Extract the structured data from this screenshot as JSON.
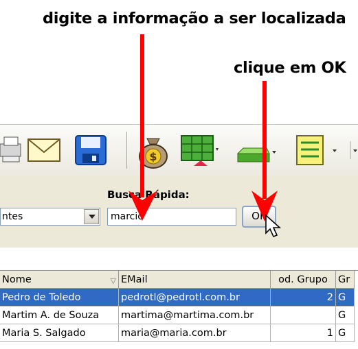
{
  "annotations": {
    "type_hint": "digite a informação a ser localizada",
    "click_hint": "clique em OK"
  },
  "toolbar": {
    "icons": [
      "printer-icon",
      "email-icon",
      "save-icon",
      "money-bag-icon",
      "spreadsheet-icon",
      "green-box-icon",
      "list-icon"
    ]
  },
  "search": {
    "label": "Busca Rápida:",
    "combo_value": "ntes",
    "input_value": "marcio",
    "ok_label": "OK"
  },
  "table": {
    "columns": [
      "Nome",
      "EMail",
      "od. Grupo",
      "Gr"
    ],
    "rows": [
      {
        "nome": "Pedro de Toledo",
        "email": "pedrotl@pedrotl.com.br",
        "grupo": "2",
        "gr": "G",
        "selected": true
      },
      {
        "nome": "Martim A. de Souza",
        "email": "martima@martima.com.br",
        "grupo": "",
        "gr": "G",
        "selected": false
      },
      {
        "nome": "Maria S. Salgado",
        "email": "maria@maria.com.br",
        "grupo": "1",
        "gr": "G",
        "selected": false
      }
    ]
  },
  "colors": {
    "arrow": "#ff0000",
    "selection": "#316ac5"
  }
}
